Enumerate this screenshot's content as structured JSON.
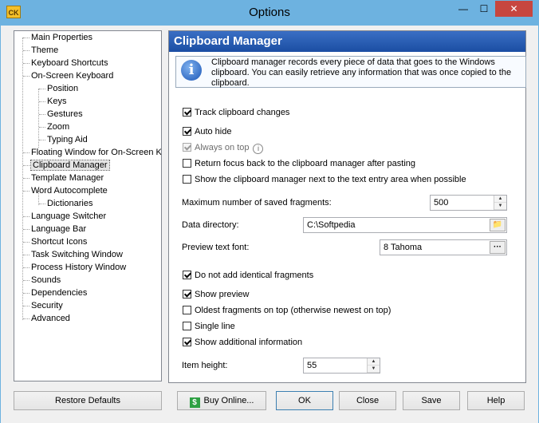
{
  "window": {
    "title": "Options",
    "app_icon_text": "CK",
    "minimize": "—",
    "maximize": "☐",
    "close": "✕"
  },
  "tree": {
    "items": [
      {
        "label": "Main Properties"
      },
      {
        "label": "Theme"
      },
      {
        "label": "Keyboard Shortcuts"
      },
      {
        "label": "On-Screen Keyboard"
      },
      {
        "label": "Position"
      },
      {
        "label": "Keys"
      },
      {
        "label": "Gestures"
      },
      {
        "label": "Zoom"
      },
      {
        "label": "Typing Aid"
      },
      {
        "label": "Floating Window for On-Screen Ke"
      },
      {
        "label": "Clipboard Manager"
      },
      {
        "label": "Template Manager"
      },
      {
        "label": "Word Autocomplete"
      },
      {
        "label": "Dictionaries"
      },
      {
        "label": "Language Switcher"
      },
      {
        "label": "Language Bar"
      },
      {
        "label": "Shortcut Icons"
      },
      {
        "label": "Task Switching Window"
      },
      {
        "label": "Process History Window"
      },
      {
        "label": "Sounds"
      },
      {
        "label": "Dependencies"
      },
      {
        "label": "Security"
      },
      {
        "label": "Advanced"
      }
    ]
  },
  "panel": {
    "title": "Clipboard Manager",
    "info": "Clipboard manager records every piece of data that goes to the Windows clipboard. You can easily retrieve any information that was once copied to the clipboard.",
    "options_top": [
      {
        "label": "Track clipboard changes",
        "checked": true
      },
      {
        "label": "Auto hide",
        "checked": true
      },
      {
        "label": "Always on top",
        "checked": true,
        "disabled": true
      },
      {
        "label": "Return focus back to the clipboard manager after pasting",
        "checked": false
      },
      {
        "label": "Show the clipboard manager next to the text entry area when possible",
        "checked": false
      }
    ],
    "max_fragments": {
      "label": "Maximum number of saved fragments:",
      "value": "500"
    },
    "data_directory": {
      "label": "Data directory:",
      "value": "C:\\Softpedia"
    },
    "preview_font": {
      "label": "Preview text font:",
      "value": "8 Tahoma",
      "button": "···"
    },
    "options_bottom": [
      {
        "label": "Do not add identical fragments",
        "checked": true
      },
      {
        "label": "Show preview",
        "checked": true
      },
      {
        "label": "Oldest fragments on top (otherwise newest on top)",
        "checked": false
      },
      {
        "label": "Single line",
        "checked": false
      },
      {
        "label": "Show additional information",
        "checked": true
      }
    ],
    "item_height": {
      "label": "Item height:",
      "value": "55"
    }
  },
  "buttons": {
    "restore": "Restore Defaults",
    "buy": "Buy Online...",
    "buy_icon": "$",
    "ok": "OK",
    "close": "Close",
    "save": "Save",
    "help": "Help"
  }
}
